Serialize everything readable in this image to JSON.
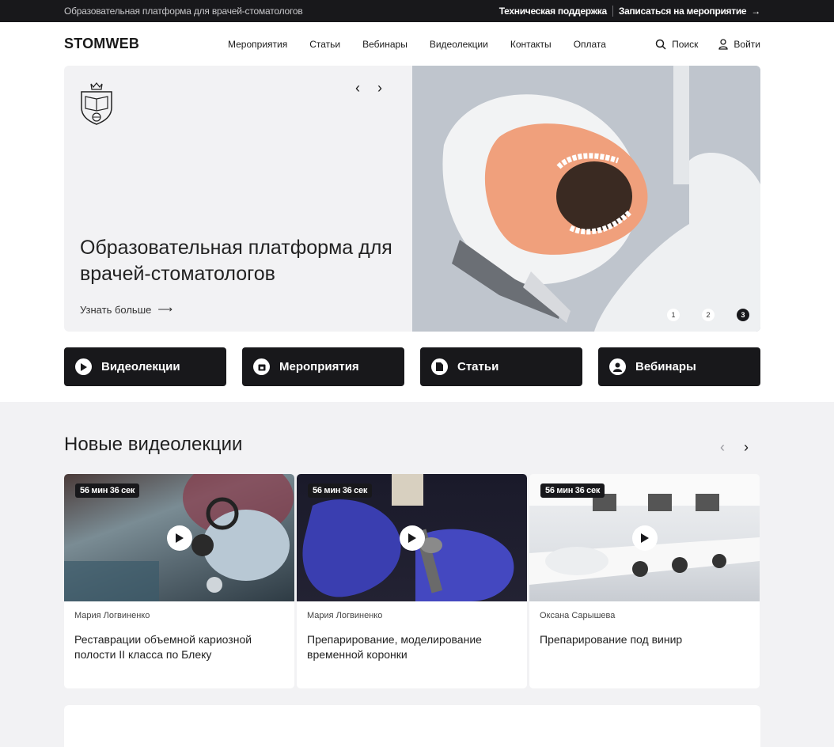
{
  "topbar": {
    "tagline": "Образовательная платформа для врачей-стоматологов",
    "support": "Техническая поддержка",
    "register": "Записаться на мероприятие"
  },
  "nav": {
    "logo": "STOMWEB",
    "menu": [
      "Мероприятия",
      "Статьи",
      "Вебинары",
      "Видеолекции",
      "Контакты",
      "Оплата"
    ],
    "search": "Поиск",
    "login": "Войти"
  },
  "hero": {
    "title": "Образовательная платформа для врачей-стоматологов",
    "more": "Узнать больше",
    "slides": [
      "1",
      "2",
      "3"
    ],
    "active_slide": 3
  },
  "categories": [
    {
      "label": "Видеолекции",
      "icon": "play-icon"
    },
    {
      "label": "Мероприятия",
      "icon": "calendar-icon"
    },
    {
      "label": "Статьи",
      "icon": "document-icon"
    },
    {
      "label": "Вебинары",
      "icon": "user-icon"
    }
  ],
  "videos": {
    "title": "Новые видеолекции",
    "items": [
      {
        "duration": "56 мин 36 сек",
        "author": "Мария Логвиненко",
        "title": "Реставрации объемной кариозной полости II класса по Блеку"
      },
      {
        "duration": "56 мин 36 сек",
        "author": "Мария Логвиненко",
        "title": "Препарирование, моделирование временной коронки"
      },
      {
        "duration": "56 мин 36 сек",
        "author": "Оксана Сарышева",
        "title": "Препарирование под винир"
      }
    ]
  },
  "colors": {
    "dark": "#18181b",
    "light_bg": "#f2f2f4",
    "accent_skin": "#f0a07c"
  }
}
